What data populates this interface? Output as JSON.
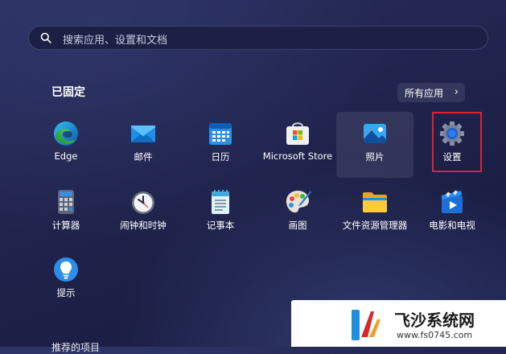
{
  "search": {
    "placeholder": "搜索应用、设置和文档"
  },
  "pinned": {
    "title": "已固定",
    "all_apps_label": "所有应用",
    "apps": [
      {
        "label": "Edge",
        "icon": "edge-icon"
      },
      {
        "label": "邮件",
        "icon": "mail-icon"
      },
      {
        "label": "日历",
        "icon": "calendar-icon"
      },
      {
        "label": "Microsoft Store",
        "icon": "store-icon"
      },
      {
        "label": "照片",
        "icon": "photos-icon"
      },
      {
        "label": "设置",
        "icon": "settings-gear-icon"
      },
      {
        "label": "计算器",
        "icon": "calculator-icon"
      },
      {
        "label": "闹钟和时钟",
        "icon": "clock-icon"
      },
      {
        "label": "记事本",
        "icon": "notepad-icon"
      },
      {
        "label": "画图",
        "icon": "paint-icon"
      },
      {
        "label": "文件资源管理器",
        "icon": "folder-icon"
      },
      {
        "label": "电影和电视",
        "icon": "movies-icon"
      },
      {
        "label": "提示",
        "icon": "tips-icon"
      }
    ]
  },
  "recommended": {
    "title": "推荐的项目"
  },
  "watermark": {
    "text": "飞沙系统网",
    "url": "www.fs0745.com"
  },
  "colors": {
    "highlight": "#e0222c",
    "background": "#222650"
  }
}
